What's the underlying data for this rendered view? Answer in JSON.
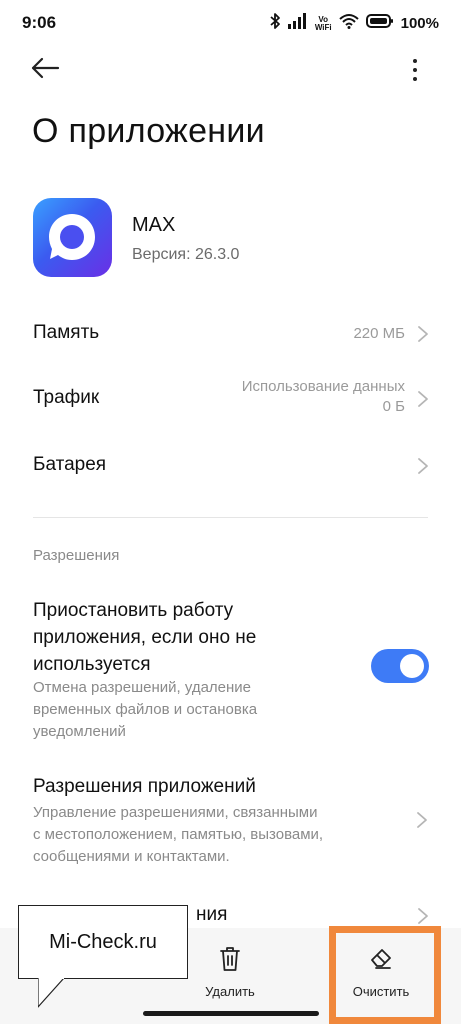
{
  "status_bar": {
    "time": "9:06",
    "vowifi_top": "Vo",
    "vowifi_bottom": "WiFi",
    "battery": "100%",
    "icons": [
      "bluetooth-icon",
      "signal-icon",
      "vowifi-icon",
      "wifi-icon",
      "battery-icon"
    ]
  },
  "app_bar": {
    "back_icon": "arrow-left-icon",
    "more_icon": "more-vertical-icon"
  },
  "page": {
    "title": "О приложении"
  },
  "app": {
    "name": "MAX",
    "version": "Версия: 26.3.0",
    "icon_colors": [
      "#3aa0ff",
      "#3b5bf0",
      "#6a2fe6"
    ]
  },
  "rows": {
    "memory": {
      "label": "Память",
      "value": "220 МБ"
    },
    "traffic": {
      "label": "Трафик",
      "value_line1": "Использование данных",
      "value_line2": "0 Б"
    },
    "battery": {
      "label": "Батарея"
    }
  },
  "permissions": {
    "section_header": "Разрешения",
    "pause_title_1": "Приостановить работу",
    "pause_title_2": "приложения, если оно не",
    "pause_title_3": "используется",
    "pause_desc_1": "Отмена разрешений, удаление",
    "pause_desc_2": "временных файлов и остановка",
    "pause_desc_3": "уведомлений",
    "pause_toggle_on": true,
    "app_perms_title": "Разрешения приложений",
    "app_perms_desc_1": "Управление разрешениями, связанными",
    "app_perms_desc_2": "с местоположением, памятью, вызовами,",
    "app_perms_desc_3": "сообщениями и контактами.",
    "partial_row_text": "ния"
  },
  "bottom_bar": {
    "delete_label": "Удалить",
    "clear_label": "Очистить",
    "delete_icon": "trash-icon",
    "clear_icon": "eraser-icon"
  },
  "overlay": {
    "watermark": "Mi-Check.ru",
    "highlight_color": "#f0883c"
  },
  "colors": {
    "accent": "#3e7bf6",
    "secondary_text": "#8a8a8a"
  }
}
